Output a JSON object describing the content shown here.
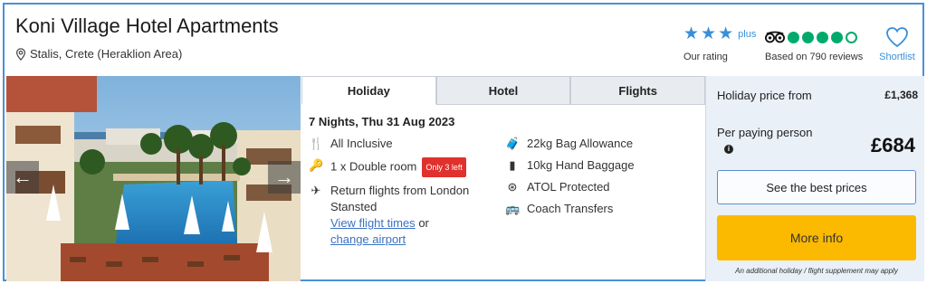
{
  "hotel": {
    "name": "Koni Village Hotel Apartments",
    "location": "Stalis, Crete (Heraklion Area)"
  },
  "rating": {
    "stars": 3,
    "plus": "plus",
    "label": "Our rating"
  },
  "tripadvisor": {
    "score": 4,
    "out_of": 5,
    "label": "Based on 790 reviews"
  },
  "shortlist": {
    "label": "Shortlist"
  },
  "gallery": {
    "prev_icon": "arrow-left-icon",
    "next_icon": "arrow-right-icon"
  },
  "tabs": [
    {
      "label": "Holiday",
      "active": true
    },
    {
      "label": "Hotel",
      "active": false
    },
    {
      "label": "Flights",
      "active": false
    }
  ],
  "details": {
    "dates": "7 Nights, Thu 31 Aug 2023",
    "left": [
      {
        "icon": "cutlery-icon",
        "text": "All Inclusive"
      },
      {
        "icon": "key-icon",
        "text": "1 x Double room",
        "badge": "Only 3 left"
      },
      {
        "icon": "plane-icon",
        "text": "Return flights from London Stansted",
        "link1": "View flight times",
        "or": "or",
        "link2": "change airport"
      }
    ],
    "right": [
      {
        "icon": "suitcase-icon",
        "text": "22kg Bag Allowance"
      },
      {
        "icon": "hand-luggage-icon",
        "text": "10kg Hand Baggage"
      },
      {
        "icon": "atol-icon",
        "text": "ATOL Protected"
      },
      {
        "icon": "bus-icon",
        "text": "Coach Transfers"
      }
    ]
  },
  "price": {
    "from_label": "Holiday price from",
    "from_value": "£1,368",
    "per_person_label": "Per paying person",
    "per_person_value": "£684",
    "best_prices_button": "See the best prices",
    "more_info_button": "More info",
    "note": "An additional holiday / flight supplement may apply"
  },
  "colors": {
    "accent": "#3a8fd8",
    "border": "#4a90d9",
    "cta": "#fbb900",
    "badge": "#e0312d",
    "tripadvisor": "#00aa6c",
    "panel": "#e9f0f8"
  }
}
